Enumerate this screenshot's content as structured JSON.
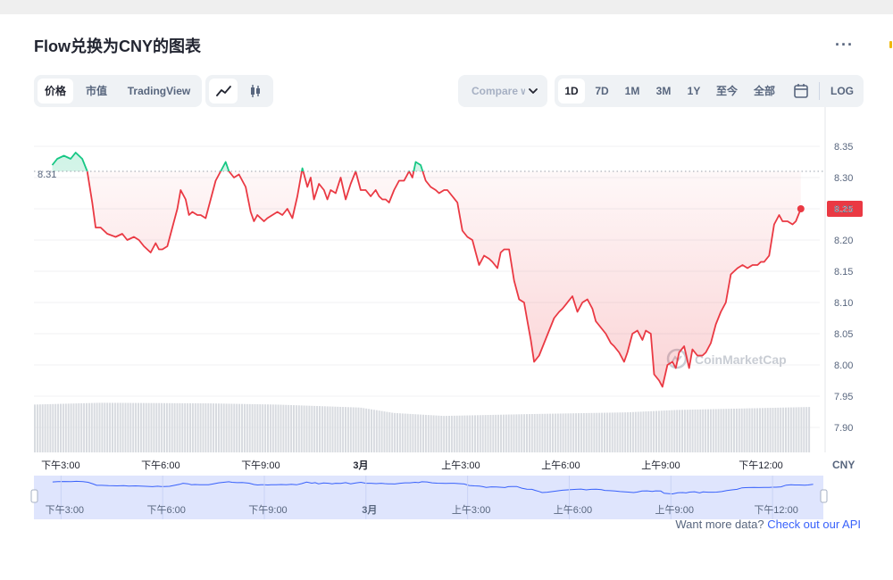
{
  "header": {
    "title": "Flow兑换为CNY的图表",
    "more_label": "···"
  },
  "toolbar": {
    "left_tabs": [
      {
        "label": "价格",
        "active": true
      },
      {
        "label": "市值",
        "active": false
      },
      {
        "label": "TradingView",
        "active": false
      }
    ],
    "chart_types": [
      {
        "icon": "line-chart-icon",
        "active": true
      },
      {
        "icon": "candlestick-icon",
        "active": false
      }
    ],
    "compare_label": "Compare with",
    "ranges": [
      {
        "label": "1D",
        "active": true
      },
      {
        "label": "7D",
        "active": false
      },
      {
        "label": "1M",
        "active": false
      },
      {
        "label": "3M",
        "active": false
      },
      {
        "label": "1Y",
        "active": false
      },
      {
        "label": "至今",
        "active": false
      },
      {
        "label": "全部",
        "active": false
      }
    ],
    "calendar_icon": "calendar-icon",
    "log_label": "LOG"
  },
  "footer": {
    "text": "Want more data? ",
    "link": "Check out our API"
  },
  "colors": {
    "up": "#16c784",
    "down": "#ea3943",
    "volume": "#d8dbe0",
    "navigator_line": "#3861fb",
    "navigator_fill": "#dfe5fd"
  },
  "chart_data": {
    "type": "line",
    "currency_label": "CNY",
    "watermark": "CoinMarketCap",
    "open_price": 8.31,
    "open_price_label": "8.31",
    "current_price": 8.25,
    "current_price_label": "8.25",
    "ylim": [
      7.86,
      8.37
    ],
    "y_ticks": [
      "8.35",
      "8.30",
      "8.25",
      "8.20",
      "8.15",
      "8.10",
      "8.05",
      "8.00",
      "7.95",
      "7.90"
    ],
    "y_tick_values": [
      8.35,
      8.3,
      8.25,
      8.2,
      8.15,
      8.1,
      8.05,
      8.0,
      7.95,
      7.9
    ],
    "xlim": [
      14.2,
      37.5
    ],
    "x_ticks": [
      {
        "h": 15,
        "label": "下午3:00"
      },
      {
        "h": 18,
        "label": "下午6:00"
      },
      {
        "h": 21,
        "label": "下午9:00"
      },
      {
        "h": 24,
        "label": "3月"
      },
      {
        "h": 27,
        "label": "上午3:00"
      },
      {
        "h": 30,
        "label": "上午6:00"
      },
      {
        "h": 33,
        "label": "上午9:00"
      },
      {
        "h": 36,
        "label": "下午12:00"
      }
    ],
    "series": [
      {
        "x": [
          14.75,
          14.9,
          15.1,
          15.3,
          15.45,
          15.65,
          15.8,
          15.95,
          16.05,
          16.2,
          16.4,
          16.65,
          16.85,
          17.0,
          17.2,
          17.35,
          17.5,
          17.7,
          17.85,
          17.95,
          18.05,
          18.2,
          18.35,
          18.5,
          18.6,
          18.75,
          18.85,
          18.95,
          19.1,
          19.2,
          19.35,
          19.5,
          19.65,
          19.8,
          19.95,
          20.05,
          20.2,
          20.35,
          20.55,
          20.7,
          20.8,
          20.9,
          21.0,
          21.1,
          21.2,
          21.35,
          21.5,
          21.65,
          21.8,
          21.95,
          22.1,
          22.25,
          22.4,
          22.5,
          22.6,
          22.75,
          22.9,
          23.0,
          23.1,
          23.25,
          23.4,
          23.55,
          23.7,
          23.85,
          24.0,
          24.15,
          24.3,
          24.45,
          24.55,
          24.65,
          24.75,
          24.85,
          25.0,
          25.15,
          25.3,
          25.45,
          25.55,
          25.65,
          25.8,
          25.95,
          26.1,
          26.25,
          26.35,
          26.5,
          26.6,
          26.75,
          26.9,
          27.05,
          27.2,
          27.35,
          27.45,
          27.55,
          27.7,
          27.85,
          27.95,
          28.1,
          28.2,
          28.3,
          28.45,
          28.6,
          28.75,
          28.9,
          29.0,
          29.1,
          29.2,
          29.35,
          29.5,
          29.65,
          29.8,
          29.95,
          30.05,
          30.2,
          30.35,
          30.5,
          30.65,
          30.8,
          30.95,
          31.05,
          31.2,
          31.35,
          31.5,
          31.6,
          31.75,
          31.9,
          32.0,
          32.15,
          32.3,
          32.45,
          32.55,
          32.7,
          32.8,
          32.95,
          33.05,
          33.2,
          33.35,
          33.45,
          33.55,
          33.7,
          33.85,
          33.95,
          34.1,
          34.25,
          34.35,
          34.5,
          34.65,
          34.8,
          34.95,
          35.1,
          35.2,
          35.3,
          35.45,
          35.6,
          35.75,
          35.9,
          36.0,
          36.1,
          36.25,
          36.4,
          36.55,
          36.65,
          36.8,
          36.95,
          37.05,
          37.2
        ],
        "y": [
          8.32,
          8.33,
          8.335,
          8.33,
          8.34,
          8.33,
          8.31,
          8.26,
          8.22,
          8.22,
          8.21,
          8.205,
          8.21,
          8.2,
          8.205,
          8.2,
          8.19,
          8.18,
          8.195,
          8.185,
          8.185,
          8.19,
          8.22,
          8.25,
          8.28,
          8.265,
          8.24,
          8.245,
          8.24,
          8.24,
          8.235,
          8.265,
          8.295,
          8.31,
          8.325,
          8.31,
          8.3,
          8.305,
          8.285,
          8.245,
          8.23,
          8.24,
          8.235,
          8.23,
          8.235,
          8.24,
          8.245,
          8.24,
          8.25,
          8.235,
          8.27,
          8.315,
          8.285,
          8.3,
          8.265,
          8.29,
          8.28,
          8.265,
          8.28,
          8.275,
          8.3,
          8.265,
          8.29,
          8.31,
          8.28,
          8.28,
          8.27,
          8.28,
          8.27,
          8.265,
          8.265,
          8.26,
          8.28,
          8.295,
          8.295,
          8.31,
          8.3,
          8.325,
          8.32,
          8.295,
          8.285,
          8.28,
          8.275,
          8.28,
          8.28,
          8.27,
          8.26,
          8.215,
          8.205,
          8.2,
          8.18,
          8.16,
          8.175,
          8.17,
          8.165,
          8.155,
          8.18,
          8.185,
          8.185,
          8.135,
          8.105,
          8.1,
          8.07,
          8.04,
          8.005,
          8.015,
          8.035,
          8.055,
          8.075,
          8.085,
          8.09,
          8.1,
          8.11,
          8.085,
          8.1,
          8.105,
          8.09,
          8.07,
          8.06,
          8.05,
          8.035,
          8.03,
          8.02,
          8.005,
          8.02,
          8.05,
          8.055,
          8.04,
          8.055,
          8.05,
          7.985,
          7.975,
          7.965,
          8.0,
          8.005,
          7.995,
          8.02,
          8.03,
          7.995,
          8.025,
          8.015,
          8.015,
          8.02,
          8.035,
          8.065,
          8.085,
          8.1,
          8.145,
          8.15,
          8.155,
          8.16,
          8.155,
          8.16,
          8.16,
          8.165,
          8.165,
          8.175,
          8.225,
          8.24,
          8.23,
          8.23,
          8.225,
          8.23,
          8.25
        ]
      }
    ],
    "volume": {
      "x_start": 14.2,
      "x_end": 37.5,
      "bars": 300,
      "level_breaks": [
        [
          14.2,
          0.8
        ],
        [
          16.2,
          0.83
        ],
        [
          19.5,
          0.82
        ],
        [
          21.5,
          0.8
        ],
        [
          24.0,
          0.75
        ],
        [
          25.0,
          0.66
        ],
        [
          26.5,
          0.61
        ],
        [
          29.0,
          0.64
        ],
        [
          32.0,
          0.67
        ],
        [
          33.5,
          0.71
        ],
        [
          37.5,
          0.76
        ]
      ]
    }
  }
}
